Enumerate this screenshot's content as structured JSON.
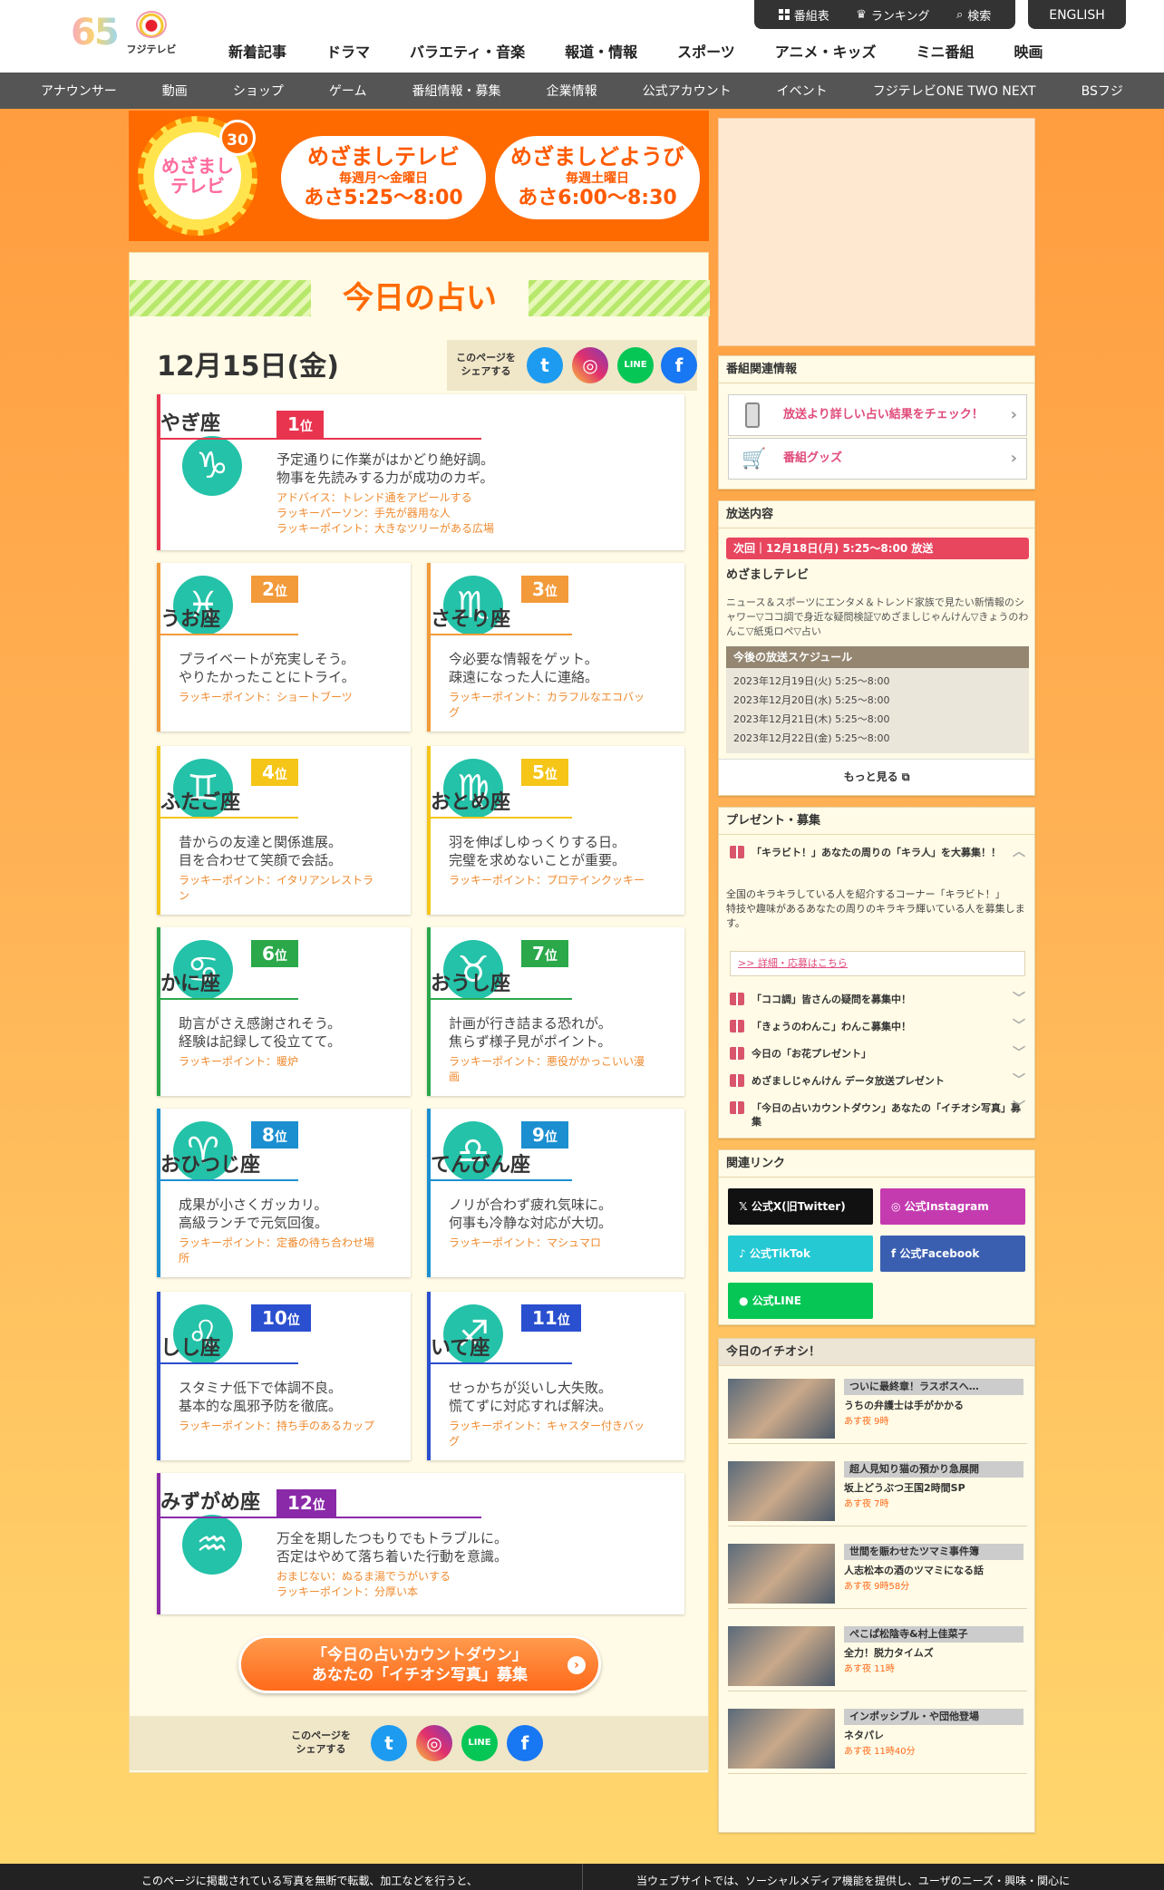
{
  "header": {
    "logo_65": "65",
    "logo_fuji": "フジテレビ",
    "nav": [
      "新着記事",
      "ドラマ",
      "バラエティ・音楽",
      "報道・情報",
      "スポーツ",
      "アニメ・キッズ",
      "ミニ番組",
      "映画"
    ],
    "util": {
      "program_table": "番組表",
      "ranking": "ランキング",
      "search": "検索"
    },
    "english": "ENGLISH",
    "subnav": [
      "アナウンサー",
      "動画",
      "ショップ",
      "ゲーム",
      "番組情報・募集",
      "企業情報",
      "公式アカウント",
      "イベント",
      "フジテレビONE TWO NEXT",
      "BSフジ"
    ]
  },
  "banner": {
    "logo_text": "めざまし\nテレビ",
    "badge": "30",
    "pill1": {
      "name": "めざましテレビ",
      "days": "毎週月～金曜日",
      "time": "あさ5:25～8:00"
    },
    "pill2": {
      "name": "めざましどようび",
      "days": "毎週土曜日",
      "time": "あさ6:00～8:30"
    }
  },
  "main": {
    "title": "今日の占い",
    "date": "12月15日(金)",
    "share_label": "このページを\nシェアする",
    "cards": [
      {
        "rank": "1",
        "rank_suffix": "位",
        "sign": "やぎ座",
        "symbol": "♑",
        "color": "#e8344e",
        "desc1": "予定通りに作業がはかどり絶好調。",
        "desc2": "物事を先読みする力が成功のカギ。",
        "lucky": [
          "アドバイス：トレンド通をアピールする",
          "ラッキーパーソン：手先が器用な人",
          "ラッキーポイント：大きなツリーがある広場"
        ]
      },
      {
        "rank": "2",
        "rank_suffix": "位",
        "sign": "うお座",
        "symbol": "♓",
        "color": "#f39a3a",
        "desc1": "プライベートが充実しそう。",
        "desc2": "やりたかったことにトライ。",
        "lucky": [
          "ラッキーポイント：ショートブーツ"
        ]
      },
      {
        "rank": "3",
        "rank_suffix": "位",
        "sign": "さそり座",
        "symbol": "♏",
        "color": "#f39a3a",
        "desc1": "今必要な情報をゲット。",
        "desc2": "疎遠になった人に連絡。",
        "lucky": [
          "ラッキーポイント：カラフルなエコバッ",
          "グ"
        ]
      },
      {
        "rank": "4",
        "rank_suffix": "位",
        "sign": "ふたご座",
        "symbol": "♊",
        "color": "#f5c518",
        "desc1": "昔からの友達と関係進展。",
        "desc2": "目を合わせて笑顔で会話。",
        "lucky": [
          "ラッキーポイント：イタリアンレストラ",
          "ン"
        ]
      },
      {
        "rank": "5",
        "rank_suffix": "位",
        "sign": "おとめ座",
        "symbol": "♍",
        "color": "#f5c518",
        "desc1": "羽を伸ばしゆっくりする日。",
        "desc2": "完璧を求めないことが重要。",
        "lucky": [
          "ラッキーポイント：プロテインクッキー"
        ]
      },
      {
        "rank": "6",
        "rank_suffix": "位",
        "sign": "かに座",
        "symbol": "♋",
        "color": "#2aa84a",
        "desc1": "助言がさえ感謝されそう。",
        "desc2": "経験は記録して役立てて。",
        "lucky": [
          "ラッキーポイント：暖炉"
        ]
      },
      {
        "rank": "7",
        "rank_suffix": "位",
        "sign": "おうし座",
        "symbol": "♉",
        "color": "#2aa84a",
        "desc1": "計画が行き詰まる恐れが。",
        "desc2": "焦らず様子見がポイント。",
        "lucky": [
          "ラッキーポイント：悪役がかっこいい漫",
          "画"
        ]
      },
      {
        "rank": "8",
        "rank_suffix": "位",
        "sign": "おひつじ座",
        "symbol": "♈",
        "color": "#1b8fd0",
        "desc1": "成果が小さくガッカリ。",
        "desc2": "高級ランチで元気回復。",
        "lucky": [
          "ラッキーポイント：定番の待ち合わせ場",
          "所"
        ]
      },
      {
        "rank": "9",
        "rank_suffix": "位",
        "sign": "てんびん座",
        "symbol": "♎",
        "color": "#1b8fd0",
        "desc1": "ノリが合わず疲れ気味に。",
        "desc2": "何事も冷静な対応が大切。",
        "lucky": [
          "ラッキーポイント：マシュマロ"
        ]
      },
      {
        "rank": "10",
        "rank_suffix": "位",
        "sign": "しし座",
        "symbol": "♌",
        "color": "#2a4fcf",
        "desc1": "スタミナ低下で体調不良。",
        "desc2": "基本的な風邪予防を徹底。",
        "lucky": [
          "ラッキーポイント：持ち手のあるカップ"
        ]
      },
      {
        "rank": "11",
        "rank_suffix": "位",
        "sign": "いて座",
        "symbol": "♐",
        "color": "#2a4fcf",
        "desc1": "せっかちが災いし大失敗。",
        "desc2": "慌てずに対応すれば解決。",
        "lucky": [
          "ラッキーポイント：キャスター付きバッ",
          "グ"
        ]
      },
      {
        "rank": "12",
        "rank_suffix": "位",
        "sign": "みずがめ座",
        "symbol": "♒",
        "color": "#8a2aa8",
        "desc1": "万全を期したつもりでもトラブルに。",
        "desc2": "否定はやめて落ち着いた行動を意識。",
        "lucky": [
          "おまじない：ぬるま湯でうがいする",
          "ラッキーポイント：分厚い本"
        ]
      }
    ],
    "cta": {
      "line1": "「今日の占いカウントダウン」",
      "line2": "あなたの「イチオシ写真」募集"
    }
  },
  "sidebar": {
    "program_info": {
      "title": "番組関連情報",
      "link1": "放送より詳しい占い結果をチェック！",
      "link2": "番組グッズ"
    },
    "broadcast": {
      "title": "放送内容",
      "next": "次回｜12月18日(月) 5:25～8:00 放送",
      "program": "めざましテレビ",
      "desc": "ニュース＆スポーツにエンタメ＆トレンド家族で見たい新情報のシャワー▽ココ調で身近な疑問検証▽めざましじゃんけん▽きょうのわんこ▽紙兎ロペ▽占い",
      "schedule_title": "今後の放送スケジュール",
      "schedule": [
        "2023年12月19日(火) 5:25～8:00",
        "2023年12月20日(水) 5:25～8:00",
        "2023年12月21日(木) 5:25～8:00",
        "2023年12月22日(金) 5:25～8:00"
      ],
      "more": "もっと見る"
    },
    "present": {
      "title": "プレゼント・募集",
      "open_item": "「キラビト！」あなたの周りの「キラ人」を大募集！！",
      "open_desc": "全国のキラキラしている人を紹介するコーナー「キラビト！」\n特技や趣味があるあなたの周りのキラキラ輝いている人を募集します。",
      "detail_link": ">> 詳細・応募はこちら",
      "items": [
        "「ココ調」皆さんの疑問を募集中！",
        "「きょうのわんこ」わんこ募集中！",
        "今日の「お花プレゼント」",
        "めざましじゃんけん データ放送プレゼント",
        "「今日の占いカウントダウン」あなたの「イチオシ写真」募集"
      ]
    },
    "links": {
      "title": "関連リンク",
      "x": "公式X(旧Twitter)",
      "instagram": "公式Instagram",
      "tiktok": "公式TikTok",
      "facebook": "公式Facebook",
      "line": "公式LINE"
    },
    "picks": {
      "title": "今日のイチオシ！",
      "items": [
        {
          "tag": "ついに最終章！ラスボスへ…",
          "title": "うちの弁護士は手がかかる",
          "time": "あす夜 9時"
        },
        {
          "tag": "超人見知り猫の預かり急展開",
          "title": "坂上どうぶつ王国2時間SP",
          "time": "あす夜 7時"
        },
        {
          "tag": "世間を賑わせたツマミ事件簿",
          "title": "人志松本の酒のツマミになる話",
          "time": "あす夜 9時58分"
        },
        {
          "tag": "ぺこぱ松陰寺&村上佳菜子",
          "title": "全力！脱力タイムズ",
          "time": "あす夜 11時"
        },
        {
          "tag": "インポッシブル・や団他登場",
          "title": "ネタパレ",
          "time": "あす夜 11時40分"
        }
      ]
    }
  },
  "footer": {
    "left": "このページに掲載されている写真を無断で転載、加工などを行うと、",
    "right": "当ウェブサイトでは、ソーシャルメディア機能を提供し、ユーザのニーズ・興味・関心に"
  }
}
